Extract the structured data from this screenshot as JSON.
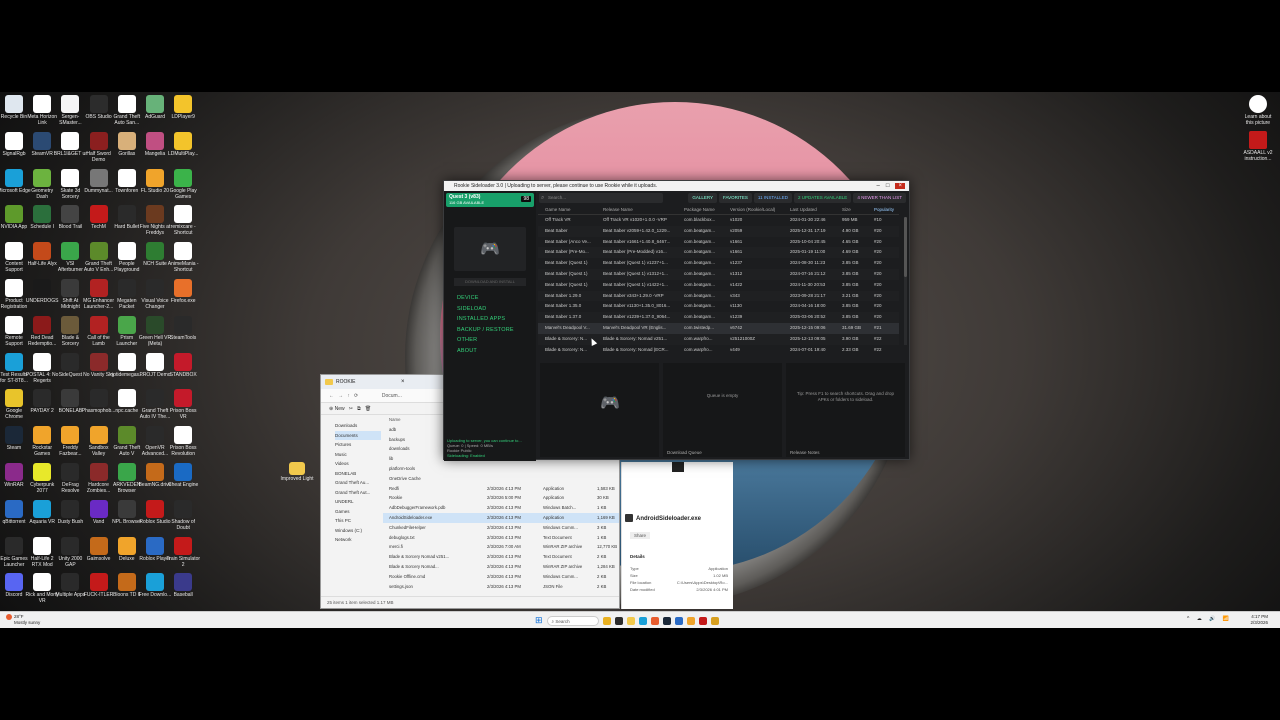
{
  "desktop": {
    "icons_left": [
      {
        "label": "Recycle Bin",
        "color": "#dfe7ef"
      },
      {
        "label": "Meta Horizon Link",
        "color": "#ffffff"
      },
      {
        "label": "Sergen-SMaster...",
        "color": "#f5f5f5"
      },
      {
        "label": "OBS Studio",
        "color": "#2c2c2c"
      },
      {
        "label": "Grand Theft Auto San...",
        "color": "#ffffff"
      },
      {
        "label": "AdGuard",
        "color": "#67b279"
      },
      {
        "label": "LDPlayer9",
        "color": "#f3c42b"
      },
      {
        "label": "SignalRgb",
        "color": "#ffffff"
      },
      {
        "label": "SteamVR",
        "color": "#2b4a73"
      },
      {
        "label": "BRL1I&GET ur",
        "color": "#ffffff"
      },
      {
        "label": "Half Sword Demo",
        "color": "#8b1f1f"
      },
      {
        "label": "Gorillas",
        "color": "#d8b07a"
      },
      {
        "label": "Mangelia",
        "color": "#c04f82"
      },
      {
        "label": "LDMultiPlay...",
        "color": "#f3c42b"
      },
      {
        "label": "Microsoft Edge",
        "color": "#1aa0d8"
      },
      {
        "label": "Geometry Dash",
        "color": "#6cb33f"
      },
      {
        "label": "Skate 3d Sorcery",
        "color": "#ffffff"
      },
      {
        "label": "Dummynat...",
        "color": "#777777"
      },
      {
        "label": "Townforen",
        "color": "#ffffff"
      },
      {
        "label": "FL Studio 20",
        "color": "#f0a42b"
      },
      {
        "label": "Google Play Games",
        "color": "#3bb34a"
      },
      {
        "label": "NVIDIA App",
        "color": "#5e9a2b"
      },
      {
        "label": "Schedule I",
        "color": "#2b6f3c"
      },
      {
        "label": "Blood Trail",
        "color": "#444444"
      },
      {
        "label": "TechM",
        "color": "#c41a1a"
      },
      {
        "label": "Hard Bullet",
        "color": "#2a2a2a"
      },
      {
        "label": "Five Nights at Freddys",
        "color": "#6b3a1f"
      },
      {
        "label": "remixcare - Shortcut",
        "color": "#ffffff"
      },
      {
        "label": "Content Support",
        "color": "#ffffff"
      },
      {
        "label": "Half-Life Alyx",
        "color": "#c44a1a"
      },
      {
        "label": "VSI Afterburner",
        "color": "#3aa64a"
      },
      {
        "label": "Grand Theft Auto V Enh...",
        "color": "#5c8a2a"
      },
      {
        "label": "People Playground",
        "color": "#ffffff"
      },
      {
        "label": "NCH Suite",
        "color": "#2e7d32"
      },
      {
        "label": "AnimeMania - Shortcut",
        "color": "#ffffff"
      },
      {
        "label": "Product Registration",
        "color": "#ffffff"
      },
      {
        "label": "UNDERDOGS",
        "color": "#1a1a1a"
      },
      {
        "label": "Shift At Midnight",
        "color": "#3a3a3a"
      },
      {
        "label": "MG Enhancer Launcher-2...",
        "color": "#b22222"
      },
      {
        "label": "Megaten Packet",
        "color": "#2a2a2a"
      },
      {
        "label": "Visual Voice Changer",
        "color": "#2a2a2a"
      },
      {
        "label": "Firefox.exe",
        "color": "#e8702a"
      },
      {
        "label": "Remote Support",
        "color": "#ffffff"
      },
      {
        "label": "Red Dead Redemptio...",
        "color": "#8b1a1a"
      },
      {
        "label": "Blade & Sorcery (Nomad)",
        "color": "#6b5a3a"
      },
      {
        "label": "Call of the Lamb",
        "color": "#b22222"
      },
      {
        "label": "Prism Launcher",
        "color": "#4aa64a"
      },
      {
        "label": "Green Hell VR (Meta)",
        "color": "#2a4a2a"
      },
      {
        "label": "SteamTools",
        "color": "#2a2a2a"
      },
      {
        "label": "Test Results for ST-8T8...",
        "color": "#1aa0d8"
      },
      {
        "label": "POSTAL 4: No Regerts",
        "color": "#ffffff"
      },
      {
        "label": "SideQuest",
        "color": "#2a2a2a"
      },
      {
        "label": "No Vanity Sky",
        "color": "#8b2a2a"
      },
      {
        "label": "riptidemegas...",
        "color": "#ffffff"
      },
      {
        "label": "PROJT Demo",
        "color": "#ffffff"
      },
      {
        "label": "STANDBOX",
        "color": "#c41a2a"
      },
      {
        "label": "Google Chrome",
        "color": "#e8c42b"
      },
      {
        "label": "PAYDAY 2",
        "color": "#2a2a2a"
      },
      {
        "label": "BONELAB",
        "color": "#3a3a3a"
      },
      {
        "label": "Phasmophob...",
        "color": "#2a2a2a"
      },
      {
        "label": "npc.cache",
        "color": "#ffffff"
      },
      {
        "label": "Grand Theft Auto IV The...",
        "color": "#2a2a2a"
      },
      {
        "label": "Prison Boss VR",
        "color": "#c41a2a"
      },
      {
        "label": "Steam",
        "color": "#1b2838"
      },
      {
        "label": "Rockstar Games Launcher",
        "color": "#f0a42b"
      },
      {
        "label": "Freddy Fazbear...",
        "color": "#f0a42b"
      },
      {
        "label": "Sandbox Valley",
        "color": "#f0a42b"
      },
      {
        "label": "Grand Theft Auto V",
        "color": "#5c8a2a"
      },
      {
        "label": "OpenVR Advanced...",
        "color": "#2a2a2a"
      },
      {
        "label": "Prison Boss Revolution",
        "color": "#ffffff"
      },
      {
        "label": "WinRAR",
        "color": "#8b2a8b"
      },
      {
        "label": "Cyberpunk 2077",
        "color": "#e8e82a"
      },
      {
        "label": "DeFrag Resolve",
        "color": "#2a2a2a"
      },
      {
        "label": "Hardcore Zombies...",
        "color": "#8b2a2a"
      },
      {
        "label": "ARKVEDEN Browser",
        "color": "#3aa64a"
      },
      {
        "label": "BeamNG.drive",
        "color": "#c46a1a"
      },
      {
        "label": "Cheat Engine",
        "color": "#1a6ac4"
      },
      {
        "label": "qBittorrent",
        "color": "#2a6ac4"
      },
      {
        "label": "Aquaria VR",
        "color": "#1aa0d8"
      },
      {
        "label": "Dusty Bush",
        "color": "#2a2a2a"
      },
      {
        "label": "Vand",
        "color": "#6a2ac4"
      },
      {
        "label": "NPL Browser",
        "color": "#3a3a3a"
      },
      {
        "label": "Roblox Studio",
        "color": "#c41a1a"
      },
      {
        "label": "Shadow of Doubt",
        "color": "#2a2a2a"
      },
      {
        "label": "Epic Games Launcher",
        "color": "#2a2a2a"
      },
      {
        "label": "Half-Life 2 RTX Mod",
        "color": "#ffffff"
      },
      {
        "label": "Unity 2000 GAP",
        "color": "#2a2a2a"
      },
      {
        "label": "Gaimsolve",
        "color": "#c46a1a"
      },
      {
        "label": "Deluxe",
        "color": "#f0a42b"
      },
      {
        "label": "Roblox Player",
        "color": "#2a6ac4"
      },
      {
        "label": "Train Simulator 2",
        "color": "#c41a1a"
      },
      {
        "label": "Discord",
        "color": "#5865f2"
      },
      {
        "label": "Rick and Morty VR",
        "color": "#ffffff"
      },
      {
        "label": "Multiple Apps",
        "color": "#2a2a2a"
      },
      {
        "label": "FUCK-ITLER",
        "color": "#c41a1a"
      },
      {
        "label": "Bloons TD 6",
        "color": "#c46a1a"
      },
      {
        "label": "Free Downlo...",
        "color": "#1aa0d8"
      },
      {
        "label": "Baseball",
        "color": "#3a3a8b"
      }
    ],
    "icons_right": [
      {
        "label": "Learn about this picture",
        "color": "#ffffff"
      },
      {
        "label": "ASDAALL v2 instruction...",
        "color": "#c41a1a"
      }
    ],
    "folder_icon": {
      "label": "Improved Light",
      "color": "#f2c94c"
    }
  },
  "rookie": {
    "title": "Rookie Sideloader 3.0 | Uploading to server, please continue to use Rookie while it uploads.",
    "device": {
      "name": "Quest 3 (v83)",
      "storage": "116 GB AVAILABLE",
      "battery": "98"
    },
    "download_button": "DOWNLOAD AND INSTALL",
    "menu": [
      "DEVICE",
      "SIDELOAD",
      "INSTALLED APPS",
      "BACKUP / RESTORE",
      "OTHER",
      "ABOUT"
    ],
    "status": {
      "upload": "Uploading to server, you can continue to...",
      "line2": "Queue: 0 | Speed: 0 MB/s",
      "line3": "Rookie Public",
      "sideloading": "Sideloading: Enabled"
    },
    "search_placeholder": "Search...",
    "tabs": {
      "gallery": "GALLERY",
      "favorites": "FAVORITES",
      "installed": "11 INSTALLED",
      "updates": "2 UPDATES AVAILABLE",
      "newer": "4 NEWER THAN LIST"
    },
    "columns": [
      "Game Name",
      "Release Name",
      "Package Name",
      "Version (Rookie/Local)",
      "Last Updated",
      "Size",
      "Popularity"
    ],
    "rows": [
      [
        "Off Track VR",
        "Off Track VR v1020+1.0.0 -VRP",
        "com.blackbox...",
        "v1020",
        "2024-01-30 22:46",
        "959 MB",
        "#10"
      ],
      [
        "Beat Saber",
        "Beat Saber v2059+1.42.0_1229...",
        "com.beatgam...",
        "v2059",
        "2025-12-31 17:19",
        "4.90 GB",
        "#20"
      ],
      [
        "Beat Saber (Anco Ve...",
        "Beat Saber v1661+1.40.8_6467...",
        "com.beatgam...",
        "v1661",
        "2025-10-04 20:45",
        "4.65 GB",
        "#20"
      ],
      [
        "Beat Saber (Pre-Mo...",
        "Beat Saber (Pre-Modded) v16...",
        "com.beatgam...",
        "v1661",
        "2025-01-19 11:00",
        "4.69 GB",
        "#20"
      ],
      [
        "Beat Saber (Quest 1)",
        "Beat Saber (Quest 1) v1237+1...",
        "com.beatgam...",
        "v1237",
        "2024-08-30 11:23",
        "3.85 GB",
        "#20"
      ],
      [
        "Beat Saber (Quest 1)",
        "Beat Saber (Quest 1) v1312+1...",
        "com.beatgam...",
        "v1312",
        "2024-07-16 21:12",
        "3.85 GB",
        "#20"
      ],
      [
        "Beat Saber (Quest 1)",
        "Beat Saber (Quest 1) v1422+1...",
        "com.beatgam...",
        "v1422",
        "2024-11-30 20:53",
        "3.85 GB",
        "#20"
      ],
      [
        "Beat Saber 1.29.0",
        "Beat Saber v343+1.29.0 -VRP",
        "com.beatgam...",
        "v343",
        "2023-09-28 21:17",
        "3.21 GB",
        "#20"
      ],
      [
        "Beat Saber 1.35.0",
        "Beat Saber v1130+1.35.0_8016...",
        "com.beatgam...",
        "v1130",
        "2024-04-16 18:00",
        "3.85 GB",
        "#20"
      ],
      [
        "Beat Saber 1.37.0",
        "Beat Saber v1239+1.37.0_9064...",
        "com.beatgam...",
        "v1239",
        "2025-03-06 20:52",
        "3.85 GB",
        "#20"
      ],
      [
        "Marvel's Deadpool V...",
        "Marvel's Deadpool VR (Englis...",
        "com.twistedp...",
        "v6742",
        "2025-12-15 09:06",
        "31.69 GB",
        "#21"
      ],
      [
        "Blade & Sorcery: N...",
        "Blade & Sorcery: Nomad v251...",
        "com.warpfro...",
        "v25121000Z",
        "2025-12-13 09:05",
        "3.90 GB",
        "#22"
      ],
      [
        "Blade & Sorcery: N...",
        "Blade & Sorcery: Nomad (ECR...",
        "com.warpfro...",
        "v449",
        "2024-07-01 19:40",
        "2.33 GB",
        "#22"
      ]
    ],
    "selected_row": 10,
    "panes": {
      "center_text": "Queue is empty",
      "right_text": "Tip: Press F1 to search shortcuts. Drag and drop APKs or folders to sideload.",
      "downloaded_label": "Download Queue",
      "notes_label": "Release Notes"
    }
  },
  "explorer": {
    "title": "ROOKIE",
    "path": "Docum...",
    "new_label": "New",
    "sidebar": [
      "Downloads",
      "Documents",
      "Pictures",
      "Music",
      "Videos",
      "BONELAB",
      "Grand Theft Au...",
      "Grand Theft Aut...",
      "UNDERL",
      "Games",
      "This PC",
      "Windows (C:)",
      "Network"
    ],
    "sidebar_active": 1,
    "name_header": "Name",
    "files": [
      [
        "adb",
        "",
        "",
        ""
      ],
      [
        "backups",
        "",
        "",
        ""
      ],
      [
        "downloads",
        "",
        "",
        ""
      ],
      [
        "lib",
        "",
        "",
        ""
      ],
      [
        "platform-tools",
        "",
        "",
        ""
      ],
      [
        "OneDrive Cache",
        "",
        "",
        ""
      ],
      [
        "Redfi",
        "2/3/2026 4:13 PM",
        "Application",
        "1,583 KB"
      ],
      [
        "Rookie",
        "2/3/2026 5:00 PM",
        "Application",
        "30 KB"
      ],
      [
        "AdbDebuggerFramework.pdb",
        "2/3/2026 4:13 PM",
        "Windows Batch...",
        "1 KB"
      ],
      [
        "AndroidSideloader.exe",
        "2/3/2026 4:13 PM",
        "Application",
        "1,169 KB"
      ],
      [
        "ChunkedFileHelper",
        "2/3/2026 4:13 PM",
        "Windows Comm...",
        "3 KB"
      ],
      [
        "debuglogs.txt",
        "2/3/2026 4:13 PM",
        "Text Document",
        "1 KB"
      ],
      [
        "merci.fi",
        "2/3/2026 7:00 AM",
        "WinRAR ZIP archive",
        "12,770 KB"
      ],
      [
        "Blade & Sorcery Nomad v251...",
        "2/3/2026 4:13 PM",
        "Text Document",
        "2 KB"
      ],
      [
        "Blade & Sorcery Nomad...",
        "2/3/2026 4:13 PM",
        "WinRAR ZIP archive",
        "1,284 KB"
      ],
      [
        "Rookie Offline.cmd",
        "2/3/2026 4:13 PM",
        "Windows Comm...",
        "2 KB"
      ],
      [
        "settings.json",
        "2/3/2026 4:13 PM",
        "JSON File",
        "2 KB"
      ]
    ],
    "selected_file": 9,
    "footer": "25 items    1 item selected 1.17 MB"
  },
  "details": {
    "file": "AndroidSideloader.exe",
    "share": "Share",
    "section": "Details",
    "props": [
      [
        "Type",
        "Application"
      ],
      [
        "Size",
        "1.02 MB"
      ],
      [
        "File location",
        "C:\\Users\\Apps\\Desktop\\Ro..."
      ],
      [
        "Date modified",
        "2/3/2026 4:01 PM"
      ]
    ]
  },
  "taskbar": {
    "weather_temp": "28°F",
    "weather_desc": "Mostly sunny",
    "search": "Search",
    "time": "4:17 PM",
    "date": "2/3/2026",
    "apps": [
      "#e8b020",
      "#2b2b2b",
      "#f2c94c",
      "#1aa0d8",
      "#e85d2f",
      "#1b2838",
      "#2a6ac4",
      "#f0a42b",
      "#c41a1a",
      "#d8a020"
    ]
  }
}
